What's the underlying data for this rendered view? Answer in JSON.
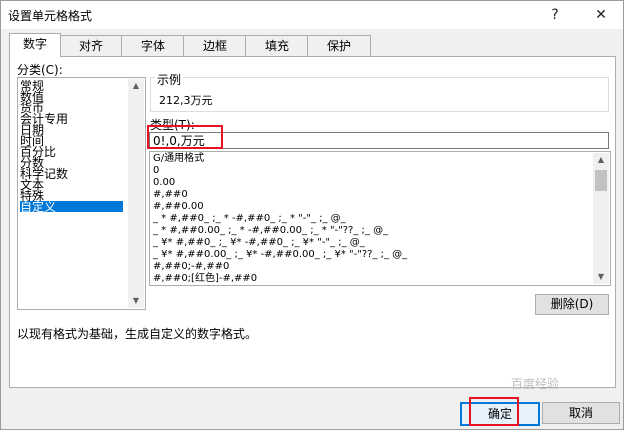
{
  "window": {
    "title": "设置单元格格式",
    "help": "?",
    "close": "✕"
  },
  "tabs": [
    "数字",
    "对齐",
    "字体",
    "边框",
    "填充",
    "保护"
  ],
  "category_label": "分类(C):",
  "categories": [
    "常规",
    "数值",
    "货币",
    "会计专用",
    "日期",
    "时间",
    "百分比",
    "分数",
    "科学记数",
    "文本",
    "特殊",
    "自定义"
  ],
  "selected_category": "自定义",
  "sample": {
    "label": "示例",
    "value": "212,3万元"
  },
  "type": {
    "label": "类型(T):",
    "value": "0!,0,万元"
  },
  "formats": [
    "G/通用格式",
    "0",
    "0.00",
    "#,##0",
    "#,##0.00",
    "_ * #,##0_ ;_ * -#,##0_ ;_ * \"-\"_ ;_ @_",
    "_ * #,##0.00_ ;_ * -#,##0.00_ ;_ * \"-\"??_ ;_ @_",
    "_ ¥* #,##0_ ;_ ¥* -#,##0_ ;_ ¥* \"-\"_ ;_ @_",
    "_ ¥* #,##0.00_ ;_ ¥* -#,##0.00_ ;_ ¥* \"-\"??_ ;_ @_",
    "#,##0;-#,##0",
    "#,##0;[红色]-#,##0"
  ],
  "delete_button": "删除(D)",
  "description": "以现有格式为基础，生成自定义的数字格式。",
  "ok_button": "确定",
  "cancel_button": "取消",
  "watermark": "百度经验",
  "colors": {
    "selection": "#0078d7",
    "highlight": "#e81123"
  }
}
